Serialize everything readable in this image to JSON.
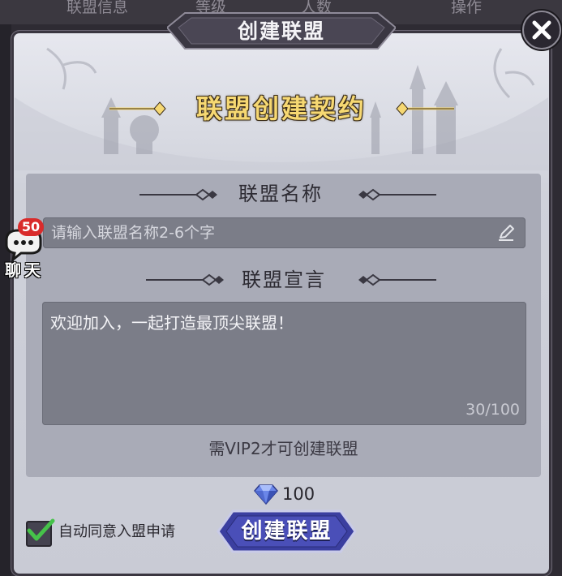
{
  "background_tabs": [
    "联盟信息",
    "等级",
    "人数",
    "操作"
  ],
  "dialog": {
    "title": "创建联盟",
    "close_icon": "close-icon",
    "banner": "联盟创建契约"
  },
  "name_section": {
    "title": "联盟名称",
    "placeholder": "请输入联盟名称2-6个字",
    "edit_icon": "pencil-icon"
  },
  "declaration_section": {
    "title": "联盟宣言",
    "text": "欢迎加入，一起打造最顶尖联盟！",
    "counter": "30/100"
  },
  "requirement": "需VIP2才可创建联盟",
  "cost": {
    "icon": "diamond-icon",
    "amount": "100"
  },
  "auto_accept": {
    "label": "自动同意入盟申请",
    "checked": true
  },
  "create_button": "创建联盟",
  "chat": {
    "badge": "50",
    "label": "聊天"
  },
  "colors": {
    "banner_gold": "#f6d872",
    "button_blue": "#3b3fa0",
    "checkbox_green": "#46c24a",
    "badge_red": "#d92b2b"
  }
}
